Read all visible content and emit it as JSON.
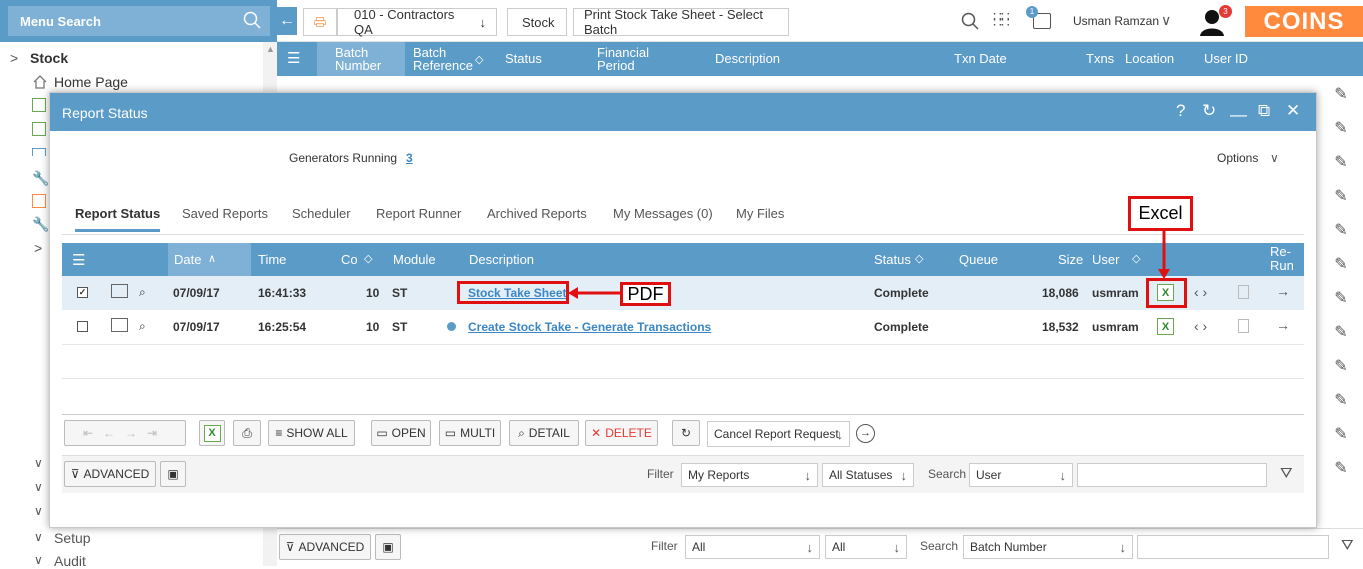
{
  "sidebar": {
    "search_placeholder": "Menu Search",
    "stock_label": "Stock",
    "home_label": "Home Page",
    "setup_label": "Setup",
    "audit_label": "Audit"
  },
  "topbar": {
    "company": "010 - Contractors QA",
    "module": "Stock",
    "page": "Print Stock Take Sheet - Select Batch",
    "user_name": "Usman Ramzan",
    "queue_badge": "1",
    "alert_badge": "3",
    "logo": "COINS"
  },
  "bg_grid": {
    "columns": [
      "Batch Number",
      "Batch Reference",
      "Status",
      "Financial Period",
      "Description",
      "Txn Date",
      "Txns",
      "Location",
      "User ID"
    ],
    "filter_label": "Filter",
    "filter_value": "All",
    "filter_status": "All",
    "search_label": "Search",
    "search_field": "Batch Number",
    "advanced_label": "ADVANCED"
  },
  "modal": {
    "title": "Report Status",
    "generators_label": "Generators Running",
    "generators_count": "3",
    "options_label": "Options",
    "tabs": [
      "Report Status",
      "Saved Reports",
      "Scheduler",
      "Report Runner",
      "Archived Reports",
      "My Messages (0)",
      "My Files"
    ],
    "columns": {
      "date": "Date",
      "time": "Time",
      "co": "Co",
      "module": "Module",
      "description": "Description",
      "status": "Status",
      "queue": "Queue",
      "size": "Size",
      "user": "User",
      "rerun": "Re-Run"
    },
    "rows": [
      {
        "date": "07/09/17",
        "time": "16:41:33",
        "co": "10",
        "module": "ST",
        "description": "Stock Take Sheet",
        "status": "Complete",
        "size": "18,086",
        "user": "usmram"
      },
      {
        "date": "07/09/17",
        "time": "16:25:54",
        "co": "10",
        "module": "ST",
        "description": "Create Stock Take - Generate Transactions",
        "status": "Complete",
        "size": "18,532",
        "user": "usmram"
      }
    ],
    "toolbar": {
      "show_all": "SHOW ALL",
      "open": "OPEN",
      "multi": "MULTI",
      "detail": "DETAIL",
      "delete": "DELETE",
      "cancel_request": "Cancel Report Request"
    },
    "filter_bar": {
      "advanced": "ADVANCED",
      "filter_label": "Filter",
      "filter_value": "My Reports",
      "status_value": "All Statuses",
      "search_label": "Search",
      "search_field": "User"
    }
  },
  "annotations": {
    "excel": "Excel",
    "pdf": "PDF"
  },
  "colors": {
    "accent": "#5b9bc8",
    "brand": "#ff8a3d",
    "annotation": "#e01010",
    "link": "#3a86c6"
  }
}
